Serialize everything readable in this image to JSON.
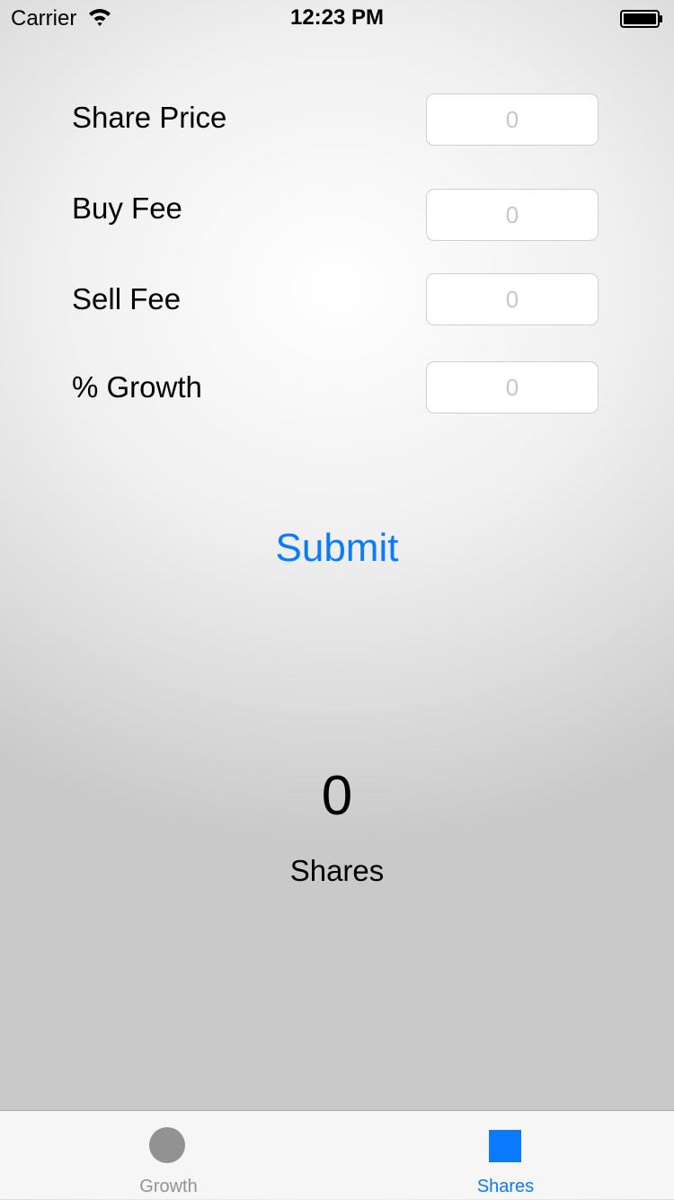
{
  "status_bar": {
    "carrier": "Carrier",
    "wifi_icon": "wifi-icon",
    "time": "12:23 PM",
    "battery_icon": "battery-icon"
  },
  "form": {
    "fields": [
      {
        "label": "Share Price",
        "value": "",
        "placeholder": "0"
      },
      {
        "label": "Buy Fee",
        "value": "",
        "placeholder": "0"
      },
      {
        "label": "Sell Fee",
        "value": "",
        "placeholder": "0"
      },
      {
        "label": "% Growth",
        "value": "",
        "placeholder": "0"
      }
    ]
  },
  "submit_label": "Submit",
  "result": {
    "value": "0",
    "label": "Shares"
  },
  "tab_bar": {
    "tabs": [
      {
        "label": "Growth",
        "icon": "circle-icon",
        "selected": false
      },
      {
        "label": "Shares",
        "icon": "square-icon",
        "selected": true
      }
    ]
  },
  "colors": {
    "accent": "#0a7aff",
    "inactive_tab": "#929292",
    "placeholder": "#c7c7cd"
  }
}
